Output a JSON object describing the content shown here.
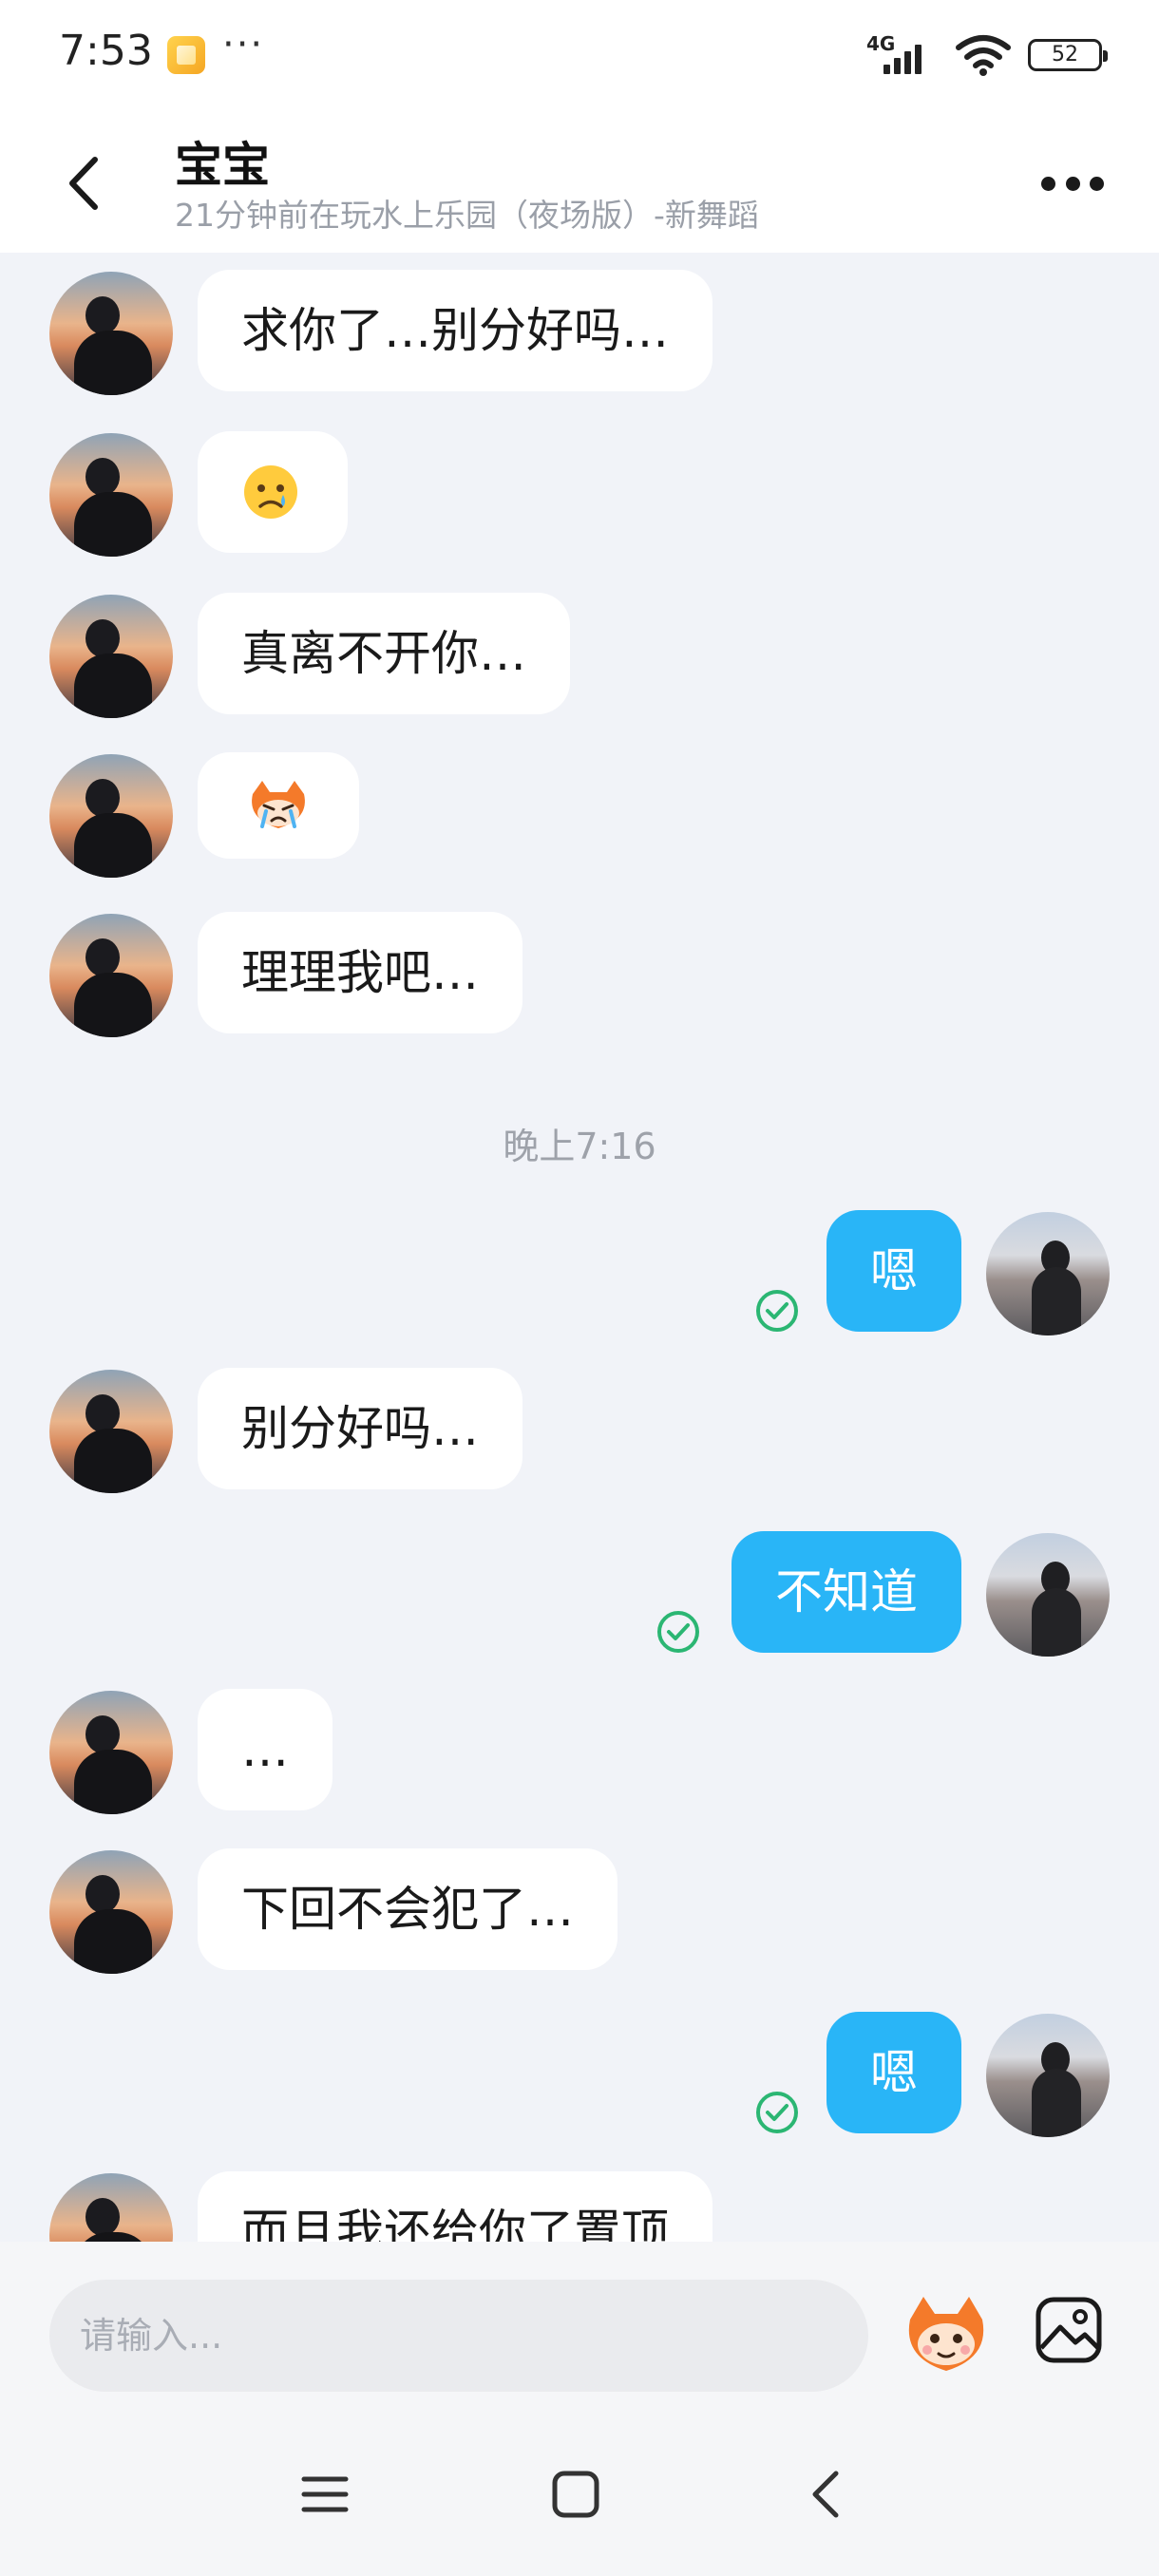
{
  "status_bar": {
    "time": "7:53",
    "more": "···",
    "network": "4G",
    "battery": "52"
  },
  "header": {
    "title": "宝宝",
    "subtitle": "21分钟前在玩水上乐园（夜场版）-新舞蹈"
  },
  "messages": {
    "m1": "求你了…别分好吗…",
    "m2_emoji": "cry-emoji",
    "m3": "真离不开你…",
    "m4_emoji": "crying-mascot-sticker",
    "m5": "理理我吧…",
    "timestamp": "晚上7:16",
    "m6": "嗯",
    "m7": "别分好吗…",
    "m8": "不知道",
    "m9": "…",
    "m10": "下回不会犯了…",
    "m11": "嗯",
    "m12": "而且我还给你了置顶"
  },
  "input": {
    "placeholder": "请输入..."
  },
  "colors": {
    "outgoing_bubble": "#29b5f7",
    "incoming_bubble": "#ffffff",
    "chat_background": "#f1f3f8",
    "read_check": "#2bb673"
  }
}
